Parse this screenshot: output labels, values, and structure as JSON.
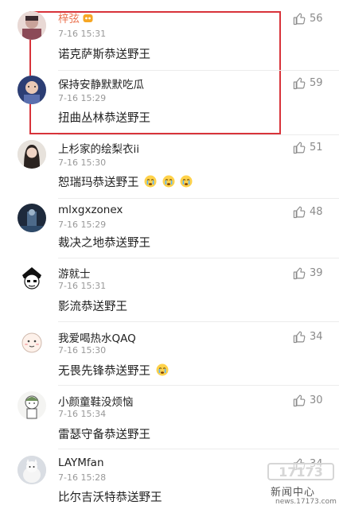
{
  "comments": [
    {
      "name": "梓弦",
      "time": "7-16 15:31",
      "text": "诺克萨斯恭送野王",
      "likes": "56"
    },
    {
      "name": "保持安静默默吃瓜",
      "time": "7-16 15:29",
      "text": "扭曲丛林恭送野王",
      "likes": "59"
    },
    {
      "name": "上杉家的绘梨衣ii",
      "time": "7-16 15:30",
      "text": "恕瑞玛恭送野王",
      "likes": "51"
    },
    {
      "name": "mlxgxzonex",
      "time": "7-16 15:29",
      "text": "裁决之地恭送野王",
      "likes": "48"
    },
    {
      "name": "游就士",
      "time": "7-16 15:31",
      "text": "影流恭送野王",
      "likes": "39"
    },
    {
      "name": "我爱喝热水QAQ",
      "time": "7-16 15:30",
      "text": "无畏先锋恭送野王",
      "likes": "34"
    },
    {
      "name": "小颜童鞋没烦恼",
      "time": "7-16 15:34",
      "text": "雷瑟守备恭送野王",
      "likes": "30"
    },
    {
      "name": "LAYMfan",
      "time": "7-16 15:28",
      "text": "比尔吉沃特恭送野王",
      "likes": "34"
    }
  ],
  "watermark": {
    "logo": "17173",
    "title": "新闻中心",
    "url": "news.17173.com"
  },
  "colors": {
    "highlight": "#d8333a",
    "vip_name": "#eb7350",
    "like": "#8a8a8a"
  }
}
